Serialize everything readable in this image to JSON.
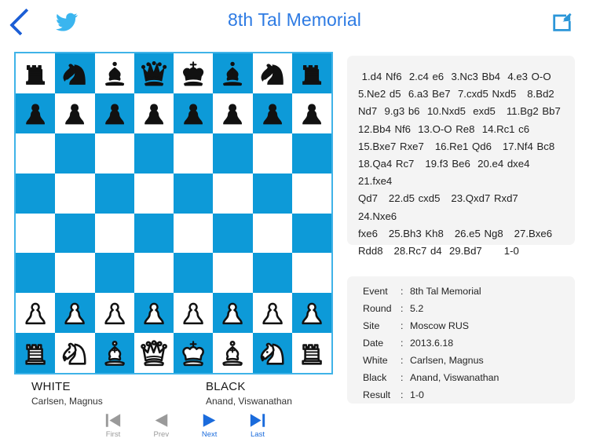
{
  "header": {
    "title": "8th Tal Memorial",
    "back_icon": "chevron-left-icon",
    "twitter_icon": "twitter-bird-icon",
    "share_icon": "share-export-icon",
    "title_color": "#2e7be3",
    "back_color": "#1d5fd6",
    "twitter_color": "#3ab5ef",
    "share_color": "#2b96d8"
  },
  "board": {
    "light_color": "#ffffff",
    "dark_color": "#0d9ad8",
    "border_color": "#3fb3e8",
    "orientation": "white-bottom",
    "position_rows": [
      [
        "bR",
        "bN",
        "bB",
        "bQ",
        "bK",
        "bB",
        "bN",
        "bR"
      ],
      [
        "bP",
        "bP",
        "bP",
        "bP",
        "bP",
        "bP",
        "bP",
        "bP"
      ],
      [
        "",
        "",
        "",
        "",
        "",
        "",
        "",
        ""
      ],
      [
        "",
        "",
        "",
        "",
        "",
        "",
        "",
        ""
      ],
      [
        "",
        "",
        "",
        "",
        "",
        "",
        "",
        ""
      ],
      [
        "",
        "",
        "",
        "",
        "",
        "",
        "",
        ""
      ],
      [
        "wP",
        "wP",
        "wP",
        "wP",
        "wP",
        "wP",
        "wP",
        "wP"
      ],
      [
        "wR",
        "wN",
        "wB",
        "wQ",
        "wK",
        "wB",
        "wN",
        "wR"
      ]
    ]
  },
  "players": {
    "white_label": "WHITE",
    "white_name": "Carlsen, Magnus",
    "black_label": "BLACK",
    "black_name": "Anand, Viswanathan"
  },
  "nav": [
    {
      "label": "First",
      "icon": "skip-to-first-icon",
      "enabled": false
    },
    {
      "label": "Prev",
      "icon": "step-backward-icon",
      "enabled": false
    },
    {
      "label": "Next",
      "icon": "step-forward-icon",
      "enabled": true
    },
    {
      "label": "Last",
      "icon": "skip-to-last-icon",
      "enabled": true
    }
  ],
  "moves": {
    "text": " 1.d4 Nf6  2.c4 e6  3.Nc3 Bb4  4.e3 O-O\n5.Ne2 d5  6.a3 Be7  7.cxd5 Nxd5   8.Bd2\nNd7  9.g3 b6  10.Nxd5  exd5   11.Bg2 Bb7\n12.Bb4 Nf6  13.O-O Re8  14.Rc1 c6\n15.Bxe7 Rxe7   16.Re1 Qd6   17.Nf4 Bc8\n18.Qa4 Rc7   19.f3 Be6  20.e4 dxe4   21.fxe4\nQd7   22.d5 cxd5   23.Qxd7 Rxd7   24.Nxe6\nfxe6   25.Bh3 Kh8   26.e5 Ng8   27.Bxe6\nRdd8   28.Rc7 d4  29.Bd7      1-0"
  },
  "info": {
    "rows": [
      {
        "key": "Event",
        "sep": ":",
        "value": "8th Tal Memorial"
      },
      {
        "key": "Round",
        "sep": ":",
        "value": "5.2"
      },
      {
        "key": "Site",
        "sep": ":",
        "value": "Moscow RUS"
      },
      {
        "key": "Date",
        "sep": ":",
        "value": "2013.6.18"
      },
      {
        "key": "White",
        "sep": ":",
        "value": "Carlsen, Magnus"
      },
      {
        "key": "Black",
        "sep": ":",
        "value": "Anand, Viswanathan"
      },
      {
        "key": "Result",
        "sep": ":",
        "value": "1-0"
      }
    ]
  }
}
